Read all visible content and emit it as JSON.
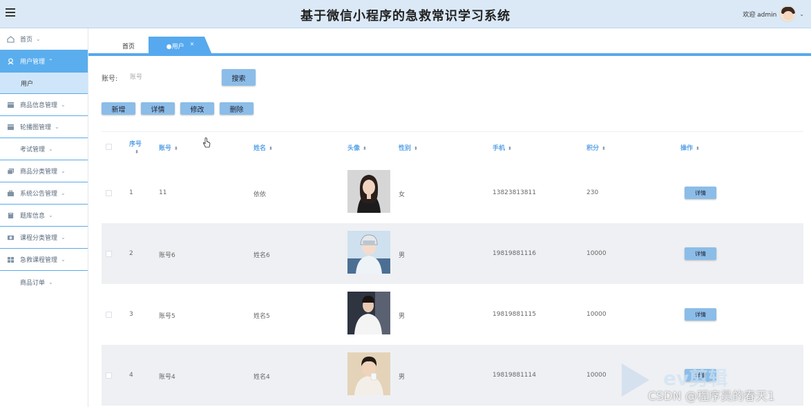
{
  "header": {
    "title": "基于微信小程序的急救常识学习系统",
    "welcome": "欢迎 admin"
  },
  "sidebar": {
    "items": [
      {
        "label": "首页",
        "icon": "home-icon"
      },
      {
        "label": "用户管理",
        "icon": "user-icon"
      },
      {
        "label": "用户",
        "icon": ""
      },
      {
        "label": "商品信息管理",
        "icon": "window-icon"
      },
      {
        "label": "轮播图管理",
        "icon": "window-icon"
      },
      {
        "label": "考试管理",
        "icon": ""
      },
      {
        "label": "商品分类管理",
        "icon": "copy-icon"
      },
      {
        "label": "系统公告管理",
        "icon": "briefcase-icon"
      },
      {
        "label": "题库信息",
        "icon": "book-icon"
      },
      {
        "label": "课程分类管理",
        "icon": "camera-icon"
      },
      {
        "label": "急救课程管理",
        "icon": "grid-icon"
      },
      {
        "label": "商品订单",
        "icon": ""
      }
    ]
  },
  "tabs": {
    "home": "首页",
    "user": "●用户",
    "close": "×"
  },
  "search": {
    "label": "账号:",
    "placeholder": "账号",
    "button": "搜索"
  },
  "toolbar": {
    "add": "新增",
    "detail": "详情",
    "edit": "修改",
    "delete": "删除"
  },
  "table": {
    "columns": {
      "seq": "序号",
      "account": "账号",
      "name": "姓名",
      "avatar": "头像",
      "gender": "性别",
      "phone": "手机",
      "points": "积分",
      "actions": "操作"
    },
    "sort_glyph": "⬍",
    "rows": [
      {
        "seq": "1",
        "account": "11",
        "name": "依依",
        "gender": "女",
        "phone": "13823813811",
        "points": "230",
        "action": "详情"
      },
      {
        "seq": "2",
        "account": "账号6",
        "name": "姓名6",
        "gender": "男",
        "phone": "19819881116",
        "points": "10000",
        "action": "详情"
      },
      {
        "seq": "3",
        "account": "账号5",
        "name": "姓名5",
        "gender": "男",
        "phone": "19819881115",
        "points": "10000",
        "action": "详情"
      },
      {
        "seq": "4",
        "account": "账号4",
        "name": "姓名4",
        "gender": "男",
        "phone": "19819881114",
        "points": "10000",
        "action": "详情"
      }
    ]
  },
  "watermark": {
    "brand": "ev剪辑",
    "credit": "CSDN @程序员的春天1"
  },
  "colors": {
    "header_bg": "#dbe9f7",
    "accent": "#56a9ee",
    "button": "#8bbde8",
    "sidebar_active": "#5aaeee",
    "sidebar_sub": "#cfe6fa"
  }
}
